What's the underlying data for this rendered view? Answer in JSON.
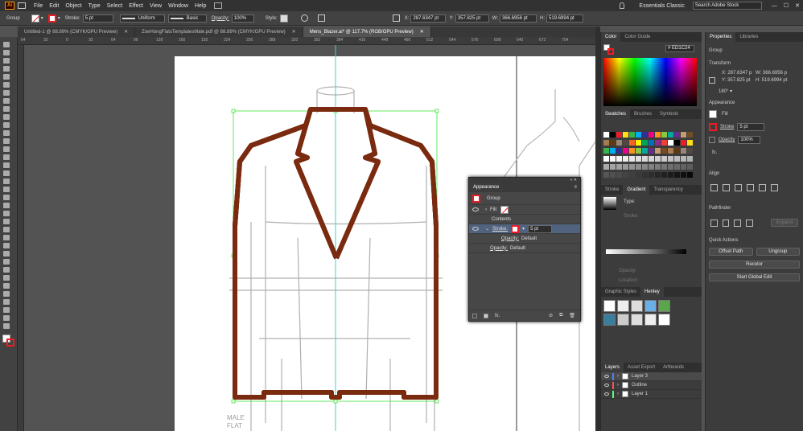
{
  "menu": {
    "logo": "Ai",
    "items": [
      "File",
      "Edit",
      "Object",
      "Type",
      "Select",
      "Effect",
      "View",
      "Window",
      "Help"
    ],
    "workspace": "Essentials Classic",
    "search_placeholder": "Search Adobe Stock"
  },
  "control": {
    "selection": "Group",
    "stroke_label": "Stroke:",
    "stroke_value": "5 pt",
    "profile": "Uniform",
    "brush": "Basic",
    "opacity_label": "Opacity:",
    "opacity_value": "100%",
    "style_label": "Style:",
    "x_label": "X:",
    "x_value": "287.6347 pt",
    "y_label": "Y:",
    "y_value": "357.825 pt",
    "w_label": "W:",
    "w_value": "366.6956 pt",
    "h_label": "H:",
    "h_value": "519.6994 pt"
  },
  "tabs": [
    {
      "label": "Untitled-1 @ 88.89% (CMYK/GPU Preview)",
      "active": false
    },
    {
      "label": "ZoeHongFlatsTemplatesMale.pdf @ 88.89% (CMYK/GPU Preview)",
      "active": false
    },
    {
      "label": "Mens_Blazer.ai* @ 117.7% (RGB/GPU Preview)",
      "active": true
    }
  ],
  "ruler_ticks": [
    "64",
    "32",
    "0",
    "32",
    "64",
    "96",
    "128",
    "160",
    "192",
    "224",
    "256",
    "288",
    "320",
    "352",
    "384",
    "416",
    "448",
    "480",
    "512",
    "544",
    "576",
    "608",
    "640",
    "672",
    "704"
  ],
  "artboard_caption": [
    "MALE",
    "FLAT"
  ],
  "color_panel": {
    "tabs": [
      "Color",
      "Color Guide"
    ],
    "hex": "ED1C24"
  },
  "swatches_panel": {
    "tabs": [
      "Swatches",
      "Brushes",
      "Symbols"
    ]
  },
  "gradient_panel": {
    "tabs": [
      "Stroke",
      "Gradient",
      "Transparency"
    ],
    "type_label": "Type:",
    "stroke_label": "Stroke:",
    "opacity_label": "Opacity:",
    "location_label": "Location:"
  },
  "styles_panel": {
    "tabs": [
      "Graphic Styles",
      "Henley"
    ]
  },
  "layers_panel": {
    "tabs": [
      "Layers",
      "Asset Export",
      "Artboards"
    ],
    "layers": [
      {
        "name": "Layer 3",
        "color": "#4f7dff"
      },
      {
        "name": "Outline",
        "color": "#ff4f4f"
      },
      {
        "name": "Layer 1",
        "color": "#4fff7a"
      }
    ]
  },
  "properties": {
    "tabs": [
      "Properties",
      "Libraries"
    ],
    "selection": "Group",
    "transform_title": "Transform",
    "x_label": "X:",
    "x": "287.6347 p",
    "y_label": "Y:",
    "y": "357.825 pt",
    "w_label": "W:",
    "w": "366.6956 p",
    "h_label": "H:",
    "h": "519.6994 pt",
    "angle": "180°",
    "appearance_title": "Appearance",
    "fill_label": "Fill",
    "stroke_label": "Stroke",
    "stroke_value": "5 pt",
    "opacity_label": "Opacity",
    "opacity_value": "100%",
    "fx": "fx.",
    "align_title": "Align",
    "pathfinder_title": "Pathfinder",
    "expand": "Expand",
    "quick_title": "Quick Actions",
    "offset_path": "Offset Path",
    "ungroup": "Ungroup",
    "recolor": "Recolor",
    "global_edit": "Start Global Edit"
  },
  "appearance": {
    "title": "Appearance",
    "group": "Group",
    "fill_label": "Fill:",
    "contents": "Contents",
    "stroke_label": "Stroke:",
    "stroke_value": "5 pt",
    "opacity_label": "Opacity:",
    "opacity_value": "Default",
    "opacity_label2": "Opacity:",
    "opacity_value2": "Default",
    "fx": "fx."
  },
  "colors": {
    "accent": "#ed1c24",
    "selection": "#39e639",
    "guide": "#3fd2d2"
  }
}
